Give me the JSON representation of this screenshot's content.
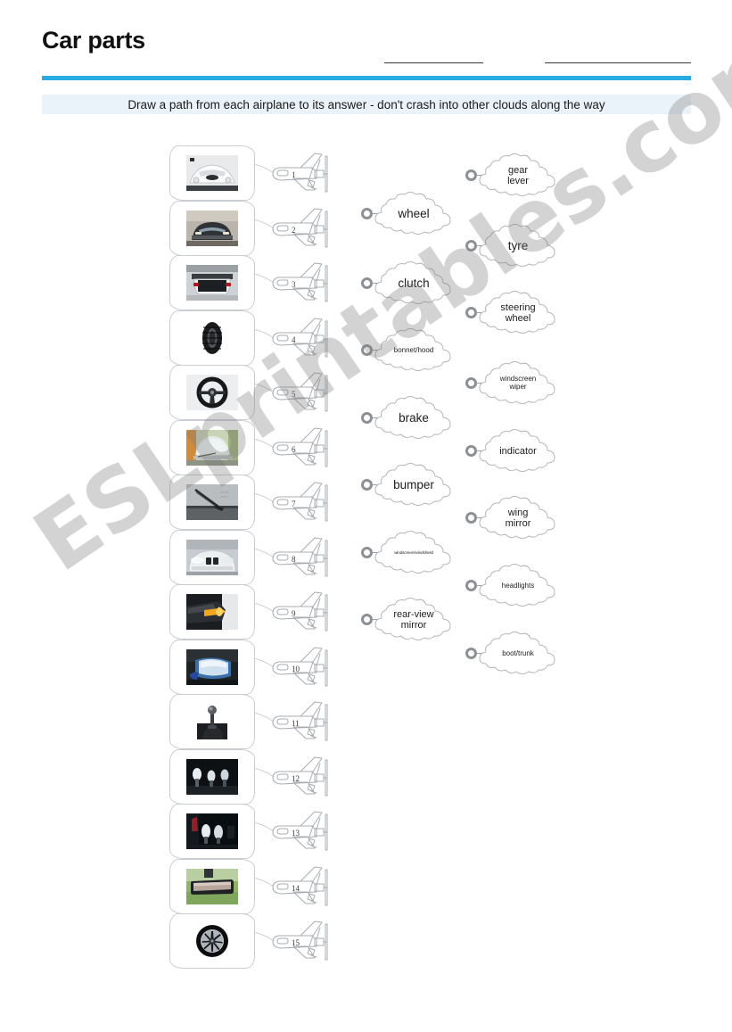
{
  "header": {
    "title": "Car parts",
    "blank_line_name": "",
    "blank_line_date": "",
    "accent_color": "#29abe2",
    "instruction": "Draw a path from each airplane to its answer - don't crash into other clouds along the way",
    "instruction_band_color": "#eaf3fa"
  },
  "questions": [
    {
      "number": "1",
      "image_alt": "white car bonnet with emblem"
    },
    {
      "number": "2",
      "image_alt": "front of a dark car with bumper"
    },
    {
      "number": "3",
      "image_alt": "open car boot / trunk"
    },
    {
      "number": "4",
      "image_alt": "black rubber tyre"
    },
    {
      "number": "5",
      "image_alt": "car steering wheel"
    },
    {
      "number": "6",
      "image_alt": "frosted car windscreen"
    },
    {
      "number": "7",
      "image_alt": "windscreen wiper blade"
    },
    {
      "number": "8",
      "image_alt": "car headlights switched on"
    },
    {
      "number": "9",
      "image_alt": "wing mirror with orange indicator lit"
    },
    {
      "number": "10",
      "image_alt": "blue car wing mirror"
    },
    {
      "number": "11",
      "image_alt": "gear lever / gear stick"
    },
    {
      "number": "12",
      "image_alt": "three pedals in footwell"
    },
    {
      "number": "13",
      "image_alt": "brake and clutch pedals"
    },
    {
      "number": "14",
      "image_alt": "rear-view mirror"
    },
    {
      "number": "15",
      "image_alt": "alloy wheel"
    }
  ],
  "clouds_left": [
    {
      "label": "wheel",
      "size": "sz-lg"
    },
    {
      "label": "clutch",
      "size": "sz-lg"
    },
    {
      "label": "bonnet/hood",
      "size": "sz-sm"
    },
    {
      "label": "brake",
      "size": "sz-lg"
    },
    {
      "label": "bumper",
      "size": "sz-lg"
    },
    {
      "label": "windscreen/windshield",
      "size": "sz-xs"
    },
    {
      "label": "rear-view\nmirror",
      "size": "sz-md"
    }
  ],
  "clouds_right": [
    {
      "label": "gear\nlever",
      "size": "sz-md"
    },
    {
      "label": "tyre",
      "size": "sz-lg"
    },
    {
      "label": "steering\nwheel",
      "size": "sz-md"
    },
    {
      "label": "windscreen\nwiper",
      "size": "sz-sm"
    },
    {
      "label": "indicator",
      "size": "sz-md"
    },
    {
      "label": "wing\nmirror",
      "size": "sz-md"
    },
    {
      "label": "headlights",
      "size": "sz-sm"
    },
    {
      "label": "boot/trunk",
      "size": "sz-sm"
    }
  ],
  "watermark": {
    "text": "ESLprintables.com"
  }
}
